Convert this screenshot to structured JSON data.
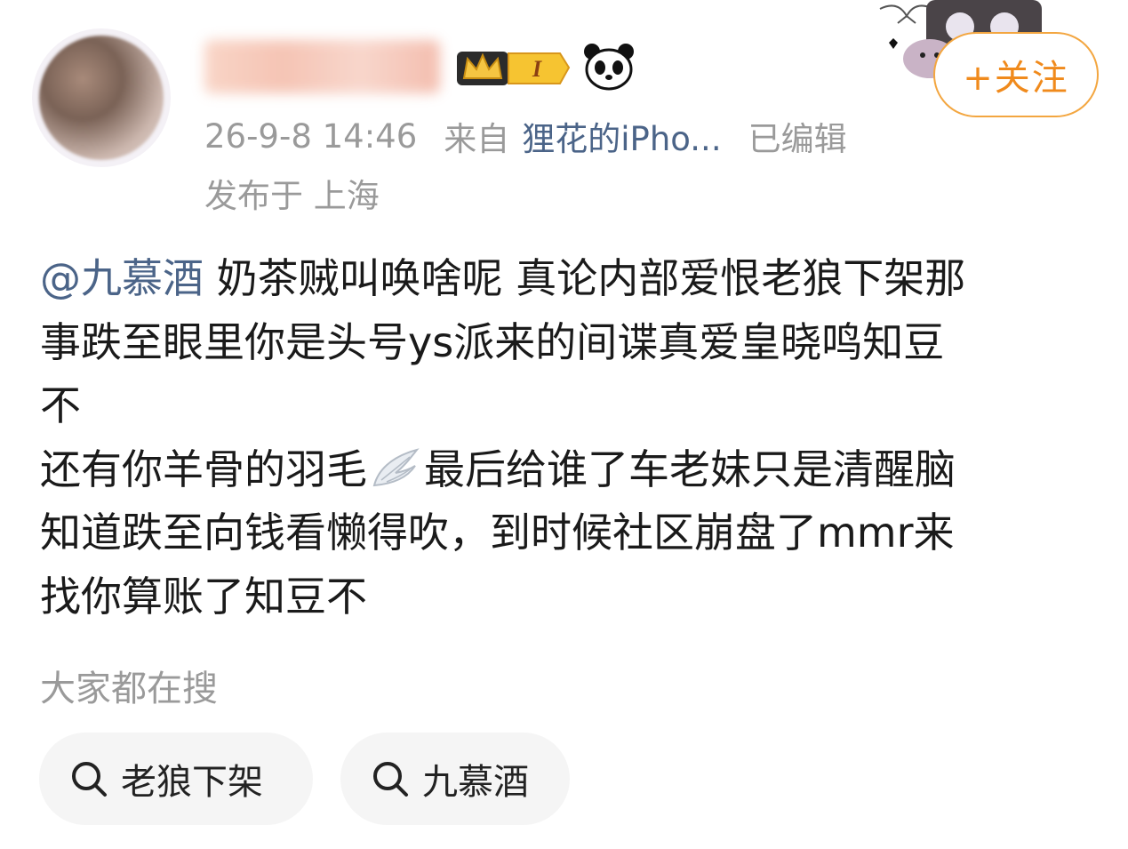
{
  "header": {
    "follow_label": "+关注",
    "badge_level": "I"
  },
  "meta": {
    "time": "26-9-8 14:46",
    "from_label": "来自",
    "device": "狸花的iPho...",
    "edited": "已编辑",
    "location": "发布于 上海"
  },
  "post": {
    "mention": "@九慕酒",
    "lines": [
      " 奶茶贼叫唤啥呢 真论内部爱恨老狼下架那",
      "事跌至眼里你是头号ys派来的间谍真爱皇晓鸣知豆",
      "不",
      "还有你羊骨的羽毛",
      "最后给谁了车老妹只是清醒脑",
      "知道跌至向钱看懒得吹，到时候社区崩盘了mmr来",
      "找你算账了知豆不"
    ]
  },
  "search": {
    "title": "大家都在搜",
    "chips": [
      {
        "label": "老狼下架"
      },
      {
        "label": "九慕酒"
      }
    ]
  },
  "colors": {
    "accent": "#f08a1c",
    "link": "#4b6488",
    "meta": "#9a9a9a"
  },
  "icons": [
    "wing-icon",
    "search-icon",
    "panda-icon",
    "crown-icon"
  ]
}
